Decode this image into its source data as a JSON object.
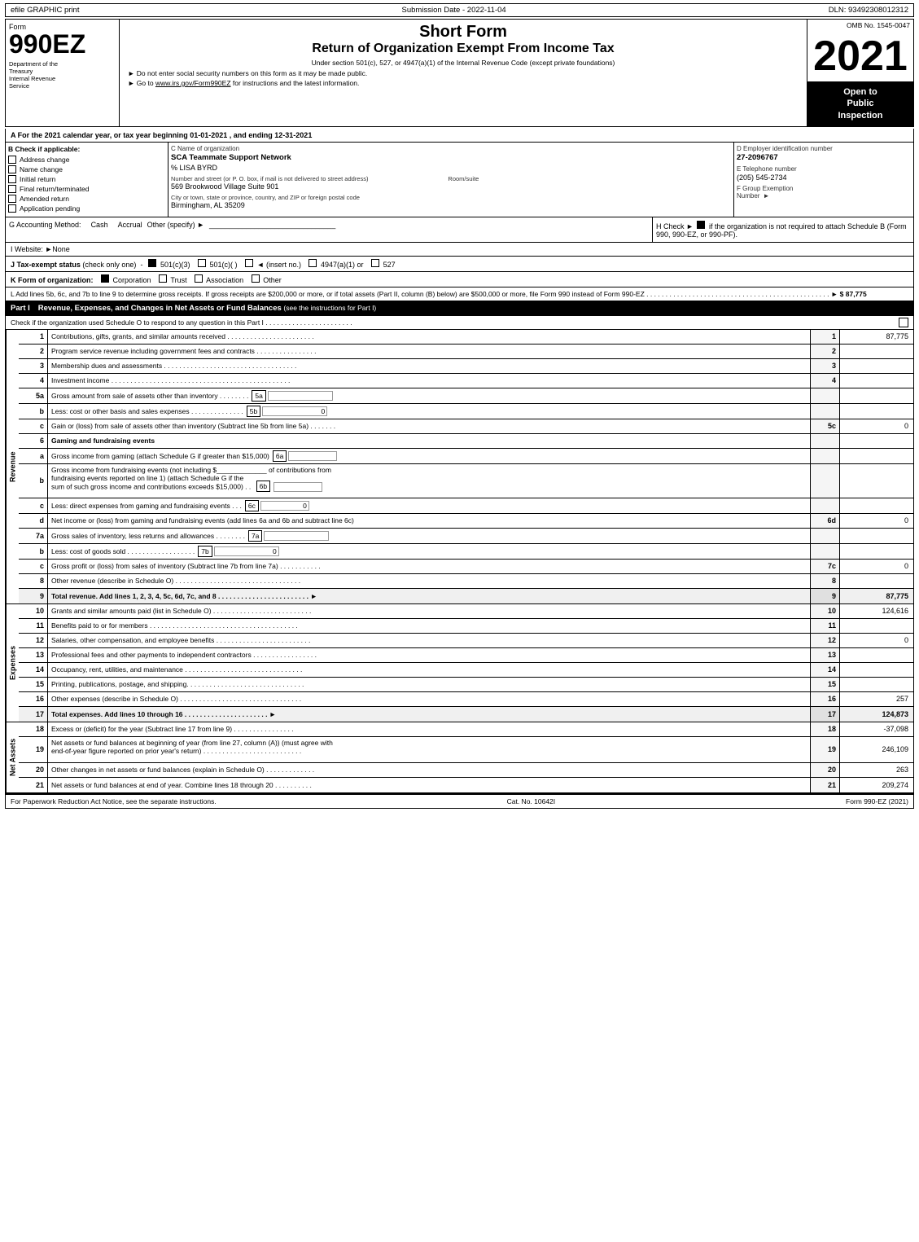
{
  "topbar": {
    "left": "efile GRAPHIC print",
    "center": "Submission Date - 2022-11-04",
    "right": "DLN: 93492308012312"
  },
  "form": {
    "label": "Form",
    "number": "990EZ",
    "dept1": "Department of the",
    "dept2": "Treasury",
    "dept3": "Internal Revenue",
    "dept4": "Service"
  },
  "title": {
    "short_form": "Short Form",
    "return_title": "Return of Organization Exempt From Income Tax",
    "subtitle": "Under section 501(c), 527, or 4947(a)(1) of the Internal Revenue Code (except private foundations)",
    "instruction1": "► Do not enter social security numbers on this form as it may be made public.",
    "instruction2": "► Go to www.irs.gov/Form990EZ for instructions and the latest information.",
    "link": "www.irs.gov/Form990EZ"
  },
  "year": {
    "number": "2021",
    "open_public_line1": "Open to",
    "open_public_line2": "Public",
    "open_public_line3": "Inspection"
  },
  "omb": {
    "label": "OMB No. 1545-0047"
  },
  "section_a": {
    "text": "A For the 2021 calendar year, or tax year beginning 01-01-2021 , and ending 12-31-2021"
  },
  "section_b": {
    "label": "B Check if applicable:",
    "items": [
      {
        "label": "Address change",
        "checked": false
      },
      {
        "label": "Name change",
        "checked": false
      },
      {
        "label": "Initial return",
        "checked": false
      },
      {
        "label": "Final return/terminated",
        "checked": false
      },
      {
        "label": "Amended return",
        "checked": false
      },
      {
        "label": "Application pending",
        "checked": false
      }
    ]
  },
  "section_c": {
    "label": "C Name of organization",
    "org_name": "SCA Teammate Support Network",
    "contact_label": "",
    "contact": "% LISA BYRD",
    "address_label": "Number and street (or P. O. box, if mail is not delivered to street address)",
    "address": "569 Brookwood Village Suite 901",
    "room_label": "Room/suite",
    "room": "",
    "city_label": "City or town, state or province, country, and ZIP or foreign postal code",
    "city": "Birmingham, AL  35209"
  },
  "section_d": {
    "label": "D Employer identification number",
    "ein": "27-2096767",
    "e_label": "E Telephone number",
    "phone": "(205) 545-2734",
    "f_label": "F Group Exemption",
    "f_label2": "Number",
    "arrow": "►"
  },
  "section_g": {
    "label": "G Accounting Method:",
    "cash_label": "Cash",
    "accrual_label": "Accrual",
    "accrual_checked": true,
    "other_label": "Other (specify) ►",
    "other_value": "_______________________________"
  },
  "section_h": {
    "label": "H Check ►",
    "checked": true,
    "text": "if the organization is not required to attach Schedule B (Form 990, 990-EZ, or 990-PF)."
  },
  "section_i": {
    "label": "I Website: ►None"
  },
  "section_j": {
    "label": "J Tax-exempt status",
    "note": "(check only one)",
    "options": [
      "501(c)(3)",
      "501(c)(  )",
      "(insert no.)",
      "4947(a)(1) or",
      "527"
    ],
    "checked_index": 0
  },
  "section_k": {
    "label": "K Form of organization:",
    "options": [
      "Corporation",
      "Trust",
      "Association",
      "Other"
    ],
    "checked_index": 0
  },
  "section_l": {
    "text": "L Add lines 5b, 6c, and 7b to line 9 to determine gross receipts. If gross receipts are $200,000 or more, or if total assets (Part II, column (B) below) are $500,000 or more, file Form 990 instead of Form 990-EZ",
    "dots": ". . . . . . . . . . . . . . . . . . . . . . . . . . . . . . . . . . . . . . . . . . . . . . . .",
    "arrow": "►",
    "value": "$ 87,775"
  },
  "part1": {
    "label": "Part I",
    "title": "Revenue, Expenses, and Changes in Net Assets or Fund Balances",
    "see_instructions": "(see the instructions for Part I)",
    "check_instruction": "Check if the organization used Schedule O to respond to any question in this Part I",
    "dots": ". . . . . . . . . . . . . . . . . . . . . . .",
    "rows": [
      {
        "num": "1",
        "label": "Contributions, gifts, grants, and similar amounts received . . . . . . . . . . . . . . . . . . . . . .",
        "box": "",
        "value": "87,775"
      },
      {
        "num": "2",
        "label": "Program service revenue including government fees and contracts . . . . . . . . . . . . . . . .",
        "box": "",
        "value": ""
      },
      {
        "num": "3",
        "label": "Membership dues and assessments . . . . . . . . . . . . . . . . . . . . . . . . . . . . . . . . . . .",
        "box": "",
        "value": ""
      },
      {
        "num": "4",
        "label": "Investment income . . . . . . . . . . . . . . . . . . . . . . . . . . . . . . . . . . . . . . . . . . . . . . .",
        "box": "",
        "value": ""
      },
      {
        "num": "5a",
        "label": "Gross amount from sale of assets other than inventory . . . . . . . .",
        "box_label": "5a",
        "box": "",
        "value": ""
      },
      {
        "num": "b",
        "label": "Less: cost or other basis and sales expenses . . . . . . . . . . . . . .",
        "box_label": "5b",
        "box": "0",
        "value": ""
      },
      {
        "num": "c",
        "label": "Gain or (loss) from sale of assets other than inventory (Subtract line 5b from line 5a) . . . . . . .",
        "box": "",
        "value": "0",
        "num_label": "5c"
      },
      {
        "num": "6",
        "label": "Gaming and fundraising events",
        "box": "",
        "value": ""
      },
      {
        "num": "a",
        "label": "Gross income from gaming (attach Schedule G if greater than $15,000)",
        "box_label": "6a",
        "box": "",
        "value": ""
      },
      {
        "num": "b",
        "label": "Gross income from fundraising events (not including $_____________ of contributions from fundraising events reported on line 1) (attach Schedule G if the sum of such gross income and contributions exceeds $15,000)  .  .",
        "box_label": "6b",
        "box": "",
        "value": ""
      },
      {
        "num": "c",
        "label": "Less: direct expenses from gaming and fundraising events     .   .   .",
        "box_label": "6c",
        "box": "0",
        "value": ""
      },
      {
        "num": "d",
        "label": "Net income or (loss) from gaming and fundraising events (add lines 6a and 6b and subtract line 6c)",
        "box": "",
        "value": "0",
        "num_label": "6d"
      },
      {
        "num": "7a",
        "label": "Gross sales of inventory, less returns and allowances . . . . . . . .",
        "box_label": "7a",
        "box": "",
        "value": ""
      },
      {
        "num": "b",
        "label": "Less: cost of goods sold     .   .   .   .   .   .   .   .   .   .   .   .   .   .   .   .   .   .",
        "box_label": "7b",
        "box": "0",
        "value": ""
      },
      {
        "num": "c",
        "label": "Gross profit or (loss) from sales of inventory (Subtract line 7b from line 7a) . . . . . . . . . . .",
        "box": "",
        "value": "0",
        "num_label": "7c"
      },
      {
        "num": "8",
        "label": "Other revenue (describe in Schedule O) . . . . . . . . . . . . . . . . . . . . . . . . . . . . . . . . .",
        "box": "",
        "value": ""
      },
      {
        "num": "9",
        "label": "Total revenue. Add lines 1, 2, 3, 4, 5c, 6d, 7c, and 8 . . . . . . . . . . . . . . . . . . . . . . . . ►",
        "box": "",
        "value": "87,775",
        "bold": true
      }
    ]
  },
  "expenses": {
    "rows": [
      {
        "num": "10",
        "label": "Grants and similar amounts paid (list in Schedule O) . . . . . . . . . . . . . . . . . . . . . . . . . .",
        "value": "124,616"
      },
      {
        "num": "11",
        "label": "Benefits paid to or for members . . . . . . . . . . . . . . . . . . . . . . . . . . . . . . . . . . . . . . .",
        "value": ""
      },
      {
        "num": "12",
        "label": "Salaries, other compensation, and employee benefits . . . . . . . . . . . . . . . . . . . . . . . . .",
        "value": "0"
      },
      {
        "num": "13",
        "label": "Professional fees and other payments to independent contractors . . . . . . . . . . . . . . . . .",
        "value": ""
      },
      {
        "num": "14",
        "label": "Occupancy, rent, utilities, and maintenance . . . . . . . . . . . . . . . . . . . . . . . . . . . . . . .",
        "value": ""
      },
      {
        "num": "15",
        "label": "Printing, publications, postage, and shipping. . . . . . . . . . . . . . . . . . . . . . . . . . . . . . .",
        "value": ""
      },
      {
        "num": "16",
        "label": "Other expenses (describe in Schedule O) . . . . . . . . . . . . . . . . . . . . . . . . . . . . . . . .",
        "value": "257"
      },
      {
        "num": "17",
        "label": "Total expenses. Add lines 10 through 16     .   .   .   .   .   .   .   .   .   .   .   .   .   .   .   .   .   .   .   .   .   .  ►",
        "value": "124,873",
        "bold": true
      }
    ]
  },
  "net_assets": {
    "rows": [
      {
        "num": "18",
        "label": "Excess or (deficit) for the year (Subtract line 17 from line 9)     .   .   .   .   .   .   .   .   .   .   .   .   .   .   .   .",
        "value": "-37,098"
      },
      {
        "num": "19",
        "label": "Net assets or fund balances at beginning of year (from line 27, column (A)) (must agree with end-of-year figure reported on prior year's return) . . . . . . . . . . . . . . . . . . . . . . . . . .",
        "value": "246,109"
      },
      {
        "num": "20",
        "label": "Other changes in net assets or fund balances (explain in Schedule O) . . . . . . . . . . . . .",
        "value": "263"
      },
      {
        "num": "21",
        "label": "Net assets or fund balances at end of year. Combine lines 18 through 20 . . . . . . . . . .",
        "value": "209,274"
      }
    ]
  },
  "footer": {
    "left": "For Paperwork Reduction Act Notice, see the separate instructions.",
    "center": "Cat. No. 10642I",
    "right": "Form 990-EZ (2021)"
  }
}
